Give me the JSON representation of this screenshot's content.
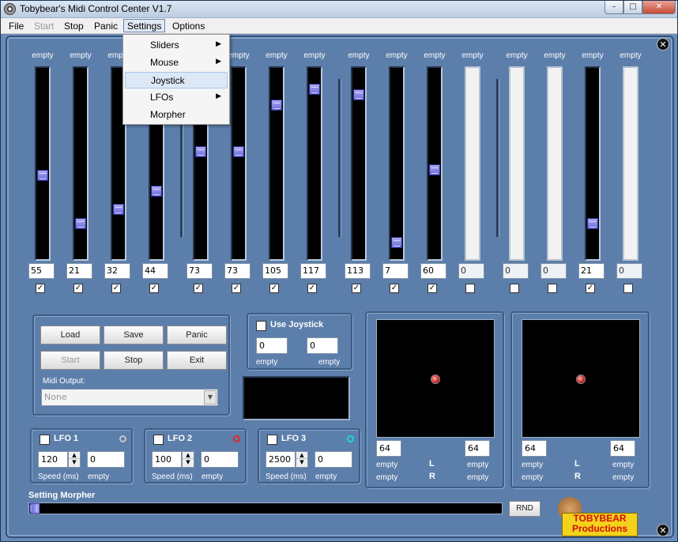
{
  "window": {
    "title": "Tobybear's Midi Control Center V1.7",
    "min": "–",
    "max": "□",
    "close": "✕"
  },
  "menu": [
    "File",
    "Start",
    "Stop",
    "Panic",
    "Settings",
    "Options"
  ],
  "settings_menu": [
    "Sliders",
    "Mouse",
    "Joystick",
    "LFOs",
    "Morpher"
  ],
  "sliders": [
    {
      "label": "empty",
      "value": "55",
      "checked": true,
      "level": 0.44
    },
    {
      "label": "empty",
      "value": "21",
      "checked": true,
      "level": 0.17
    },
    {
      "label": "empty",
      "value": "32",
      "checked": true,
      "level": 0.25
    },
    {
      "label": "empty",
      "value": "44",
      "checked": true,
      "level": 0.35
    },
    {
      "label": "empty",
      "value": "73",
      "checked": true,
      "level": 0.57
    },
    {
      "label": "empty",
      "value": "73",
      "checked": true,
      "level": 0.57
    },
    {
      "label": "empty",
      "value": "105",
      "checked": true,
      "level": 0.83
    },
    {
      "label": "empty",
      "value": "117",
      "checked": true,
      "level": 0.92
    },
    {
      "label": "empty",
      "value": "113",
      "checked": true,
      "level": 0.89
    },
    {
      "label": "empty",
      "value": "7",
      "checked": true,
      "level": 0.06
    },
    {
      "label": "empty",
      "value": "60",
      "checked": true,
      "level": 0.47
    },
    {
      "label": "empty",
      "value": "0",
      "checked": false,
      "level": 0
    },
    {
      "label": "empty",
      "value": "0",
      "checked": false,
      "level": 0
    },
    {
      "label": "empty",
      "value": "0",
      "checked": false,
      "level": 0
    },
    {
      "label": "empty",
      "value": "21",
      "checked": true,
      "level": 0.17
    },
    {
      "label": "empty",
      "value": "0",
      "checked": false,
      "level": 0
    }
  ],
  "controls": {
    "load": "Load",
    "save": "Save",
    "panic": "Panic",
    "start": "Start",
    "stop": "Stop",
    "exit": "Exit",
    "midi_output_label": "Midi Output:",
    "midi_output_value": "None"
  },
  "joystick": {
    "label": "Use Joystick",
    "x": "0",
    "y": "0",
    "x_name": "empty",
    "y_name": "empty"
  },
  "lfos": [
    {
      "label": "LFO 1",
      "speed": "120",
      "value": "0",
      "speed_label": "Speed (ms)",
      "target": "empty",
      "color": "#c8c8c8"
    },
    {
      "label": "LFO 2",
      "speed": "100",
      "value": "0",
      "speed_label": "Speed (ms)",
      "target": "empty",
      "color": "#e0282a"
    },
    {
      "label": "LFO 3",
      "speed": "2500",
      "value": "0",
      "speed_label": "Speed (ms)",
      "target": "empty",
      "color": "#19d4e0"
    }
  ],
  "pads": [
    {
      "x_value": "64",
      "y_value": "64",
      "row1_left": "empty",
      "row1_mid": "L",
      "row1_right": "empty",
      "row2_left": "empty",
      "row2_mid": "R",
      "row2_right": "empty"
    },
    {
      "x_value": "64",
      "y_value": "64",
      "row1_left": "empty",
      "row1_mid": "L",
      "row1_right": "empty",
      "row2_left": "empty",
      "row2_mid": "R",
      "row2_right": "empty"
    }
  ],
  "morpher": {
    "label": "Setting Morpher",
    "rnd": "RND"
  },
  "logo": {
    "line1": "TOBYBEAR",
    "line2": "Productions"
  }
}
